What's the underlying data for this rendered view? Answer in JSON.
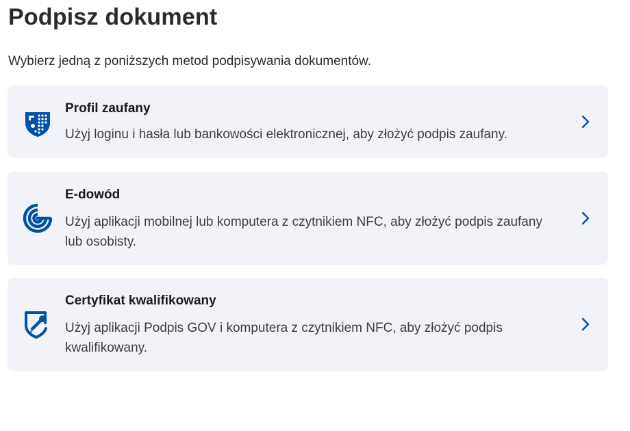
{
  "header": {
    "title": "Podpisz dokument",
    "intro": "Wybierz jedną z poniższych metod podpisywania dokumentów."
  },
  "colors": {
    "accent": "#0052a5",
    "card_bg": "#f2f3f8"
  },
  "methods": [
    {
      "title": "Profil zaufany",
      "description": "Użyj loginu i hasła lub bankowości elektronicznej, aby złożyć podpis zaufany.",
      "icon": "trusted-profile-shield-icon"
    },
    {
      "title": "E-dowód",
      "description": "Użyj aplikacji mobilnej lub komputera z czytnikiem NFC, aby złożyć podpis zaufany lub osobisty.",
      "icon": "e-id-logo-icon"
    },
    {
      "title": "Certyfikat kwalifikowany",
      "description": "Użyj aplikacji Podpis GOV i komputera z czytnikiem NFC, aby złożyć podpis kwalifikowany.",
      "icon": "shield-pen-icon"
    }
  ]
}
